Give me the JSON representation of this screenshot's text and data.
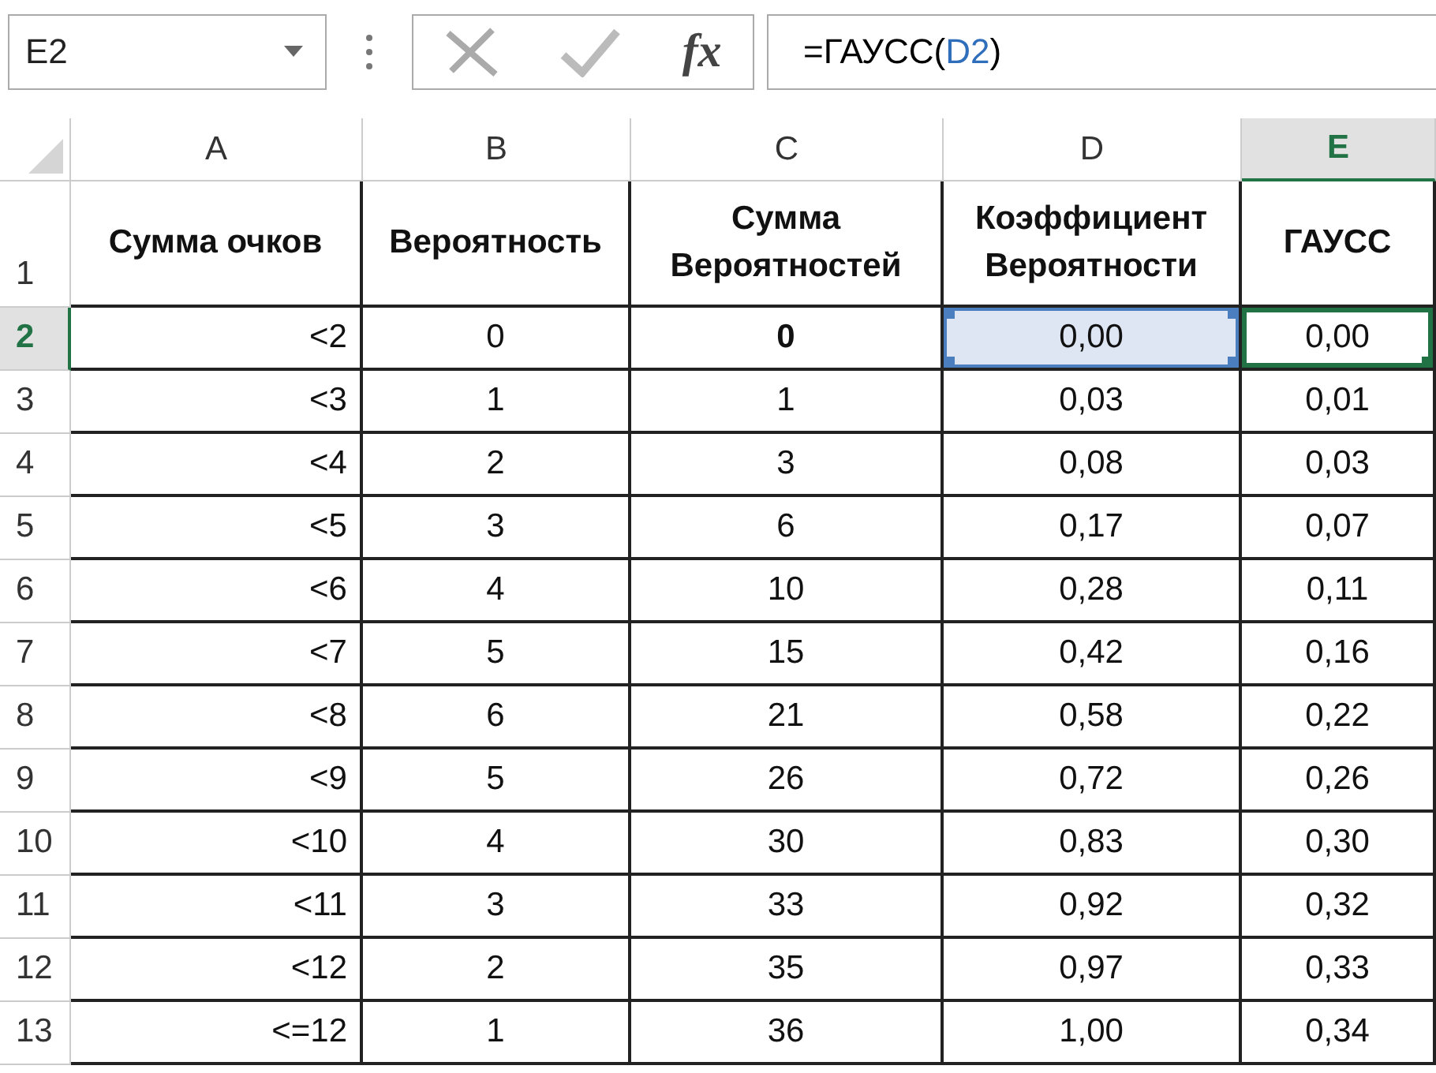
{
  "name_box": {
    "value": "E2"
  },
  "formula_buttons": {
    "function_label": "fx"
  },
  "formula_bar": {
    "segments": [
      {
        "text": "=ГАУСС(",
        "color": "#000000"
      },
      {
        "text": "D2",
        "color": "#2f6eba"
      },
      {
        "text": ")",
        "color": "#000000"
      }
    ]
  },
  "columns": [
    {
      "label": "A",
      "selected": false
    },
    {
      "label": "B",
      "selected": false
    },
    {
      "label": "C",
      "selected": false
    },
    {
      "label": "D",
      "selected": false
    },
    {
      "label": "E",
      "selected": true
    }
  ],
  "header_row": {
    "number": "1",
    "selected": false,
    "cells": [
      "Сумма очков",
      "Вероятность",
      "Сумма Вероятностей",
      "Коэффициент Вероятности",
      "ГАУСС"
    ]
  },
  "rows": [
    {
      "number": "2",
      "selected": true,
      "cells": [
        {
          "text": "<2",
          "bold": false,
          "active": false,
          "referenced": false
        },
        {
          "text": "0",
          "bold": false,
          "active": false,
          "referenced": false
        },
        {
          "text": "0",
          "bold": true,
          "active": false,
          "referenced": false
        },
        {
          "text": "0,00",
          "bold": false,
          "active": false,
          "referenced": true
        },
        {
          "text": "0,00",
          "bold": false,
          "active": true,
          "referenced": false
        }
      ]
    },
    {
      "number": "3",
      "selected": false,
      "cells": [
        {
          "text": "<3",
          "bold": false,
          "active": false,
          "referenced": false
        },
        {
          "text": "1",
          "bold": false,
          "active": false,
          "referenced": false
        },
        {
          "text": "1",
          "bold": false,
          "active": false,
          "referenced": false
        },
        {
          "text": "0,03",
          "bold": false,
          "active": false,
          "referenced": false
        },
        {
          "text": "0,01",
          "bold": false,
          "active": false,
          "referenced": false
        }
      ]
    },
    {
      "number": "4",
      "selected": false,
      "cells": [
        {
          "text": "<4",
          "bold": false,
          "active": false,
          "referenced": false
        },
        {
          "text": "2",
          "bold": false,
          "active": false,
          "referenced": false
        },
        {
          "text": "3",
          "bold": false,
          "active": false,
          "referenced": false
        },
        {
          "text": "0,08",
          "bold": false,
          "active": false,
          "referenced": false
        },
        {
          "text": "0,03",
          "bold": false,
          "active": false,
          "referenced": false
        }
      ]
    },
    {
      "number": "5",
      "selected": false,
      "cells": [
        {
          "text": "<5",
          "bold": false,
          "active": false,
          "referenced": false
        },
        {
          "text": "3",
          "bold": false,
          "active": false,
          "referenced": false
        },
        {
          "text": "6",
          "bold": false,
          "active": false,
          "referenced": false
        },
        {
          "text": "0,17",
          "bold": false,
          "active": false,
          "referenced": false
        },
        {
          "text": "0,07",
          "bold": false,
          "active": false,
          "referenced": false
        }
      ]
    },
    {
      "number": "6",
      "selected": false,
      "cells": [
        {
          "text": "<6",
          "bold": false,
          "active": false,
          "referenced": false
        },
        {
          "text": "4",
          "bold": false,
          "active": false,
          "referenced": false
        },
        {
          "text": "10",
          "bold": false,
          "active": false,
          "referenced": false
        },
        {
          "text": "0,28",
          "bold": false,
          "active": false,
          "referenced": false
        },
        {
          "text": "0,11",
          "bold": false,
          "active": false,
          "referenced": false
        }
      ]
    },
    {
      "number": "7",
      "selected": false,
      "cells": [
        {
          "text": "<7",
          "bold": false,
          "active": false,
          "referenced": false
        },
        {
          "text": "5",
          "bold": false,
          "active": false,
          "referenced": false
        },
        {
          "text": "15",
          "bold": false,
          "active": false,
          "referenced": false
        },
        {
          "text": "0,42",
          "bold": false,
          "active": false,
          "referenced": false
        },
        {
          "text": "0,16",
          "bold": false,
          "active": false,
          "referenced": false
        }
      ]
    },
    {
      "number": "8",
      "selected": false,
      "cells": [
        {
          "text": "<8",
          "bold": false,
          "active": false,
          "referenced": false
        },
        {
          "text": "6",
          "bold": false,
          "active": false,
          "referenced": false
        },
        {
          "text": "21",
          "bold": false,
          "active": false,
          "referenced": false
        },
        {
          "text": "0,58",
          "bold": false,
          "active": false,
          "referenced": false
        },
        {
          "text": "0,22",
          "bold": false,
          "active": false,
          "referenced": false
        }
      ]
    },
    {
      "number": "9",
      "selected": false,
      "cells": [
        {
          "text": "<9",
          "bold": false,
          "active": false,
          "referenced": false
        },
        {
          "text": "5",
          "bold": false,
          "active": false,
          "referenced": false
        },
        {
          "text": "26",
          "bold": false,
          "active": false,
          "referenced": false
        },
        {
          "text": "0,72",
          "bold": false,
          "active": false,
          "referenced": false
        },
        {
          "text": "0,26",
          "bold": false,
          "active": false,
          "referenced": false
        }
      ]
    },
    {
      "number": "10",
      "selected": false,
      "cells": [
        {
          "text": "<10",
          "bold": false,
          "active": false,
          "referenced": false
        },
        {
          "text": "4",
          "bold": false,
          "active": false,
          "referenced": false
        },
        {
          "text": "30",
          "bold": false,
          "active": false,
          "referenced": false
        },
        {
          "text": "0,83",
          "bold": false,
          "active": false,
          "referenced": false
        },
        {
          "text": "0,30",
          "bold": false,
          "active": false,
          "referenced": false
        }
      ]
    },
    {
      "number": "11",
      "selected": false,
      "cells": [
        {
          "text": "<11",
          "bold": false,
          "active": false,
          "referenced": false
        },
        {
          "text": "3",
          "bold": false,
          "active": false,
          "referenced": false
        },
        {
          "text": "33",
          "bold": false,
          "active": false,
          "referenced": false
        },
        {
          "text": "0,92",
          "bold": false,
          "active": false,
          "referenced": false
        },
        {
          "text": "0,32",
          "bold": false,
          "active": false,
          "referenced": false
        }
      ]
    },
    {
      "number": "12",
      "selected": false,
      "cells": [
        {
          "text": "<12",
          "bold": false,
          "active": false,
          "referenced": false
        },
        {
          "text": "2",
          "bold": false,
          "active": false,
          "referenced": false
        },
        {
          "text": "35",
          "bold": false,
          "active": false,
          "referenced": false
        },
        {
          "text": "0,97",
          "bold": false,
          "active": false,
          "referenced": false
        },
        {
          "text": "0,33",
          "bold": false,
          "active": false,
          "referenced": false
        }
      ]
    },
    {
      "number": "13",
      "selected": false,
      "cells": [
        {
          "text": "<=12",
          "bold": false,
          "active": false,
          "referenced": false
        },
        {
          "text": "1",
          "bold": false,
          "active": false,
          "referenced": false
        },
        {
          "text": "36",
          "bold": false,
          "active": false,
          "referenced": false
        },
        {
          "text": "1,00",
          "bold": false,
          "active": false,
          "referenced": false
        },
        {
          "text": "0,34",
          "bold": false,
          "active": false,
          "referenced": false
        }
      ]
    }
  ]
}
